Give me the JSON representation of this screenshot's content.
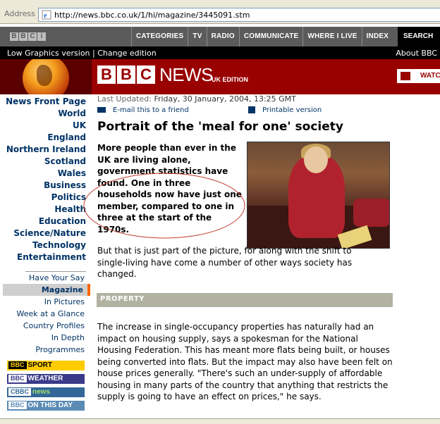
{
  "browser": {
    "address_label": "Address",
    "url": "http://news.bbc.co.uk/1/hi/magazine/3445091.stm"
  },
  "topnav": {
    "bbc_letters": [
      "B",
      "B",
      "C",
      "i"
    ],
    "items": [
      "CATEGORIES",
      "TV",
      "RADIO",
      "COMMUNICATE",
      "WHERE I LIVE",
      "INDEX"
    ],
    "search_label": "SEARCH"
  },
  "subbar": {
    "low_graphics": "Low Graphics version",
    "separator": "|",
    "change_edition": "Change edition",
    "about": "About BBC"
  },
  "banner": {
    "logo_letters": [
      "B",
      "B",
      "C"
    ],
    "logo_word": "NEWS",
    "edition": "UK EDITION",
    "watch": "WATC"
  },
  "leftnav": {
    "main_items": [
      "News Front Page",
      "World",
      "UK",
      "England",
      "Northern Ireland",
      "Scotland",
      "Wales",
      "Business",
      "Politics",
      "Health",
      "Education",
      "Science/Nature",
      "Technology",
      "Entertainment"
    ],
    "sub_items": [
      "Have Your Say",
      "Magazine",
      "In Pictures",
      "Week at a Glance",
      "Country Profiles",
      "In Depth",
      "Programmes"
    ],
    "active": "Magazine",
    "badges": [
      {
        "label": "SPORT",
        "color": "#ffcc00"
      },
      {
        "label": "WEATHER",
        "color": "#3a3a8a"
      },
      {
        "label": "news",
        "color": "#336699"
      },
      {
        "label": "ON THIS DAY",
        "color": "#5b8bb5"
      }
    ],
    "bbc_badge_prefix": "BBC",
    "cbbc_badge_prefix": "CBBC"
  },
  "article": {
    "updated_label": "Last Updated:",
    "updated_value": "Friday, 30 January, 2004, 13:25 GMT",
    "email_link": "E-mail this to a friend",
    "print_link": "Printable version",
    "headline": "Portrait of the 'meal for one' society",
    "intro": "More people than ever in the UK are living alone, government statistics have found. One in three households now have just one member, compared to one in three at the start of the 1970s.",
    "para1": "But that is just part of the picture, for along with the shift to single-living have come a number of other ways society has changed.",
    "section_heading": "PROPERTY",
    "para2": "The increase in single-occupancy properties has naturally had an impact on housing supply, says a spokesman for the National Housing Federation. This has meant more flats being built, or houses being converted into flats. But the impact may also have been felt on house prices generally. \"There's such an under-supply of affordable housing in many parts of the country that anything that restricts the supply is going to have an effect on prices,\" he says."
  },
  "colors": {
    "bbc_red": "#990000",
    "nav_blue": "#003366",
    "annotation": "#c0392b",
    "section_bg": "#b2b2a2"
  }
}
